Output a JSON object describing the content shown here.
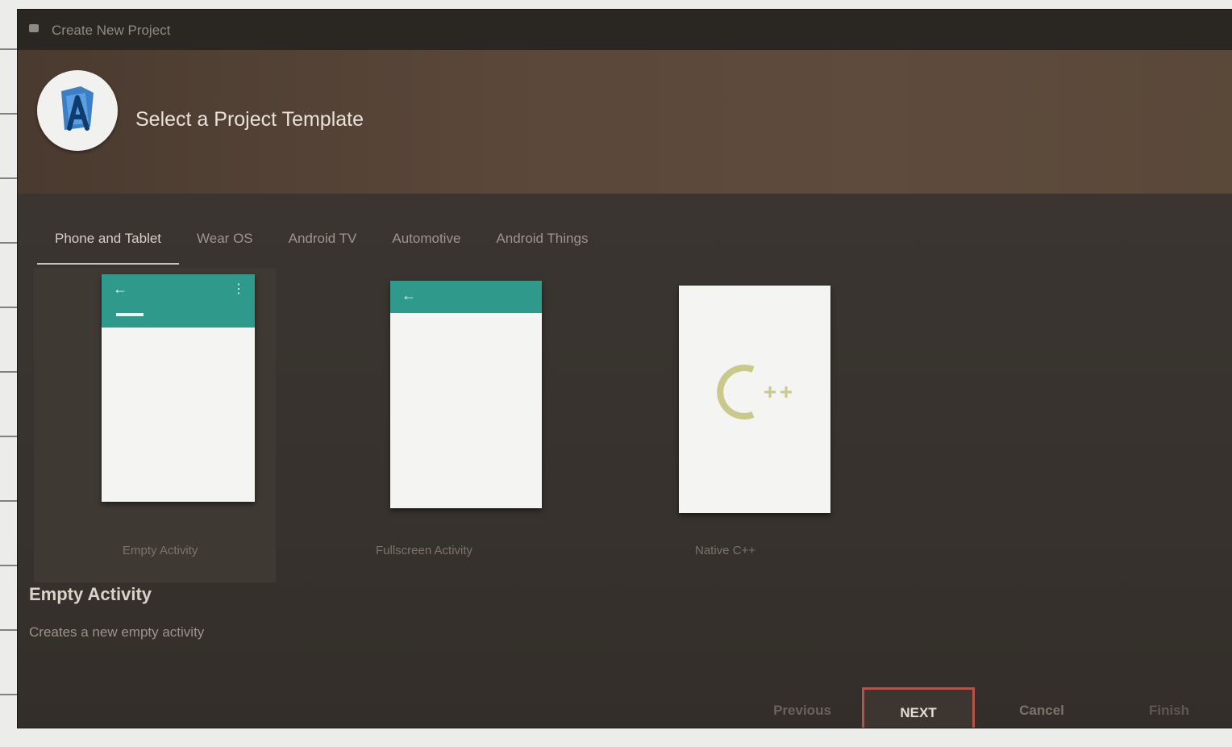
{
  "window": {
    "title": "Create New Project"
  },
  "header": {
    "title": "Select a Project Template"
  },
  "tabs": [
    {
      "label": "Phone and Tablet",
      "active": true
    },
    {
      "label": "Wear OS",
      "active": false
    },
    {
      "label": "Android TV",
      "active": false
    },
    {
      "label": "Automotive",
      "active": false
    },
    {
      "label": "Android Things",
      "active": false
    }
  ],
  "templates": [
    {
      "caption": "Empty Activity",
      "appbar": true,
      "selected": true
    },
    {
      "caption": "Fullscreen Activity",
      "appbar": true,
      "selected": false
    },
    {
      "caption": "Native C++",
      "icon": "cpp-icon",
      "selected": false
    }
  ],
  "description": {
    "title": "Empty Activity",
    "text": "Creates a new empty activity"
  },
  "buttons": {
    "previous": "Previous",
    "next": "NEXT",
    "cancel": "Cancel",
    "finish": "Finish"
  },
  "colors": {
    "accent_teal": "#2f9a8b",
    "next_border": "#b5524a",
    "cpp_icon": "#c8c98a"
  }
}
